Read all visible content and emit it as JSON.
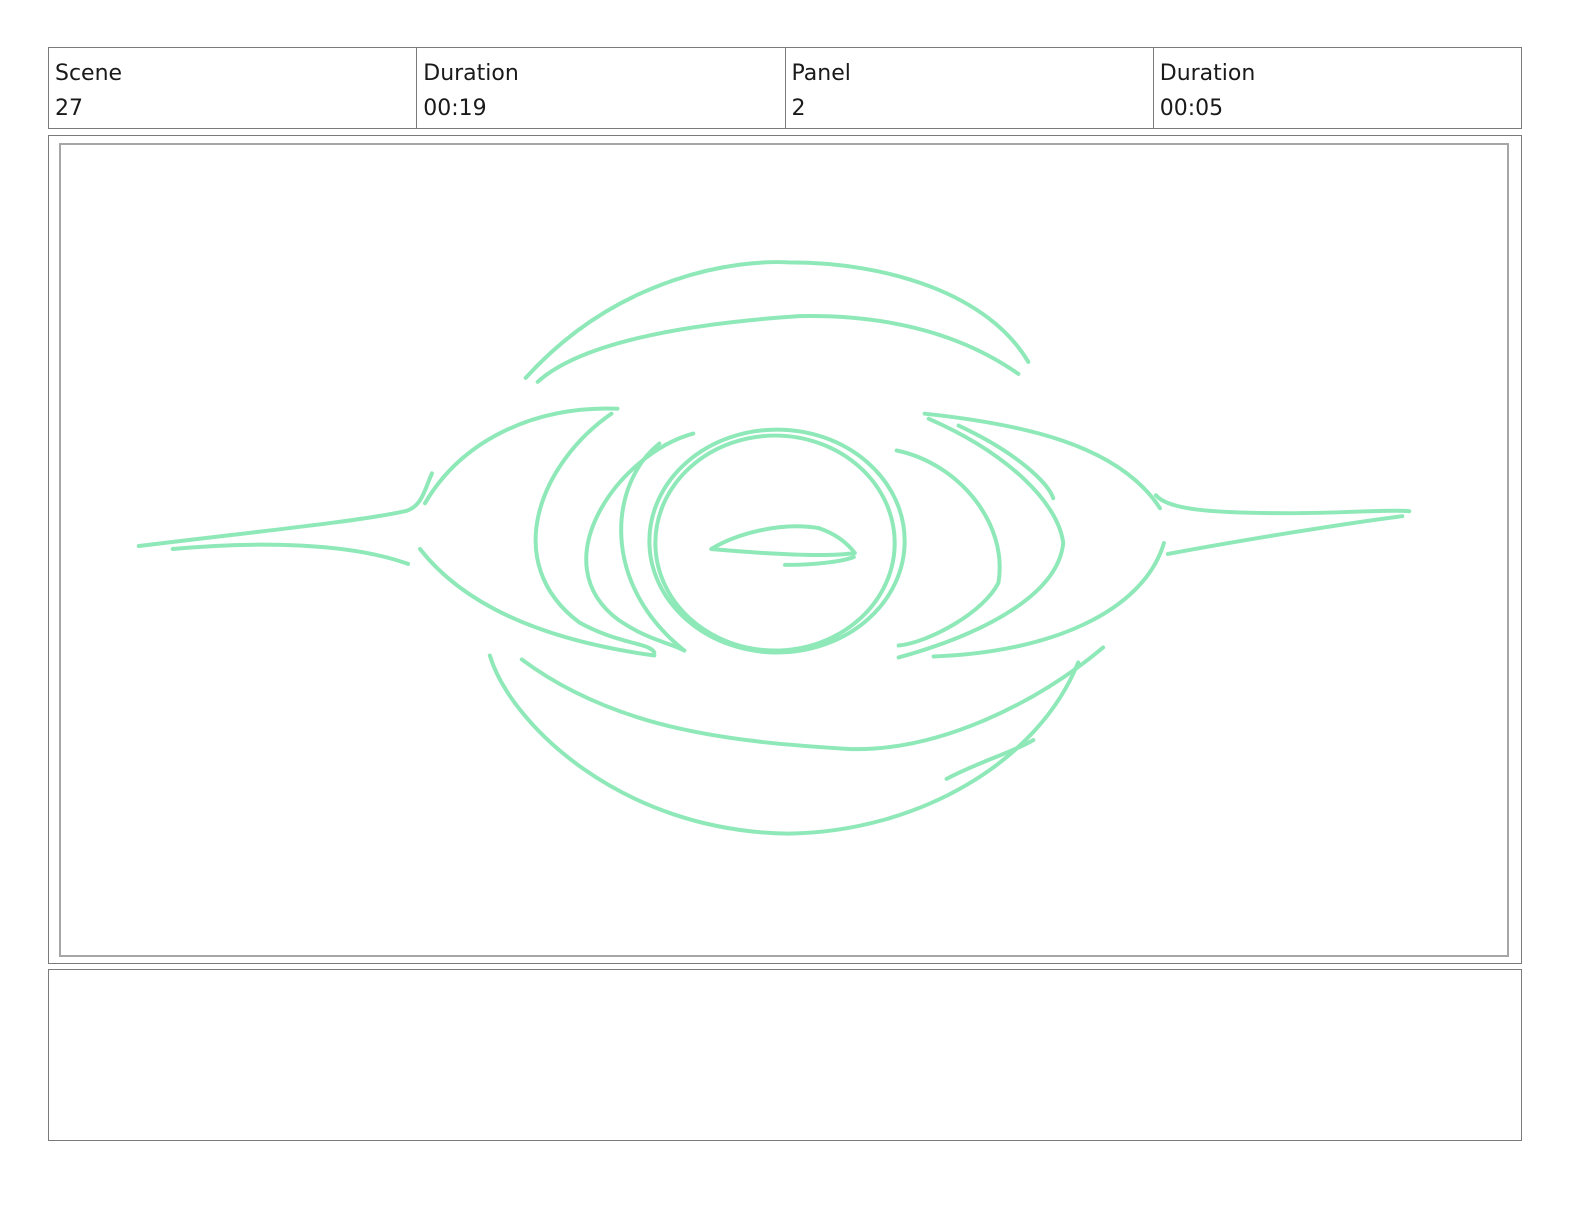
{
  "info_bar": {
    "cells": [
      {
        "label": "Scene",
        "value": "27"
      },
      {
        "label": "Duration",
        "value": "00:19"
      },
      {
        "label": "Panel",
        "value": "2"
      },
      {
        "label": "Duration",
        "value": "00:05"
      }
    ]
  },
  "panel": {
    "sketch_color": "#8ee8b8",
    "subject": "eye-sketch"
  },
  "notes": {
    "text": ""
  }
}
